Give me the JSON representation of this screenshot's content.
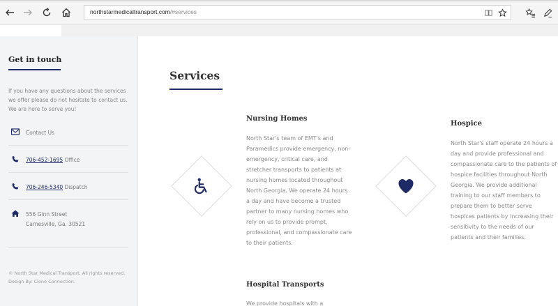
{
  "browser": {
    "url_host": "northstarmedicaltransport.com",
    "url_path": "/#services"
  },
  "sidebar": {
    "title": "Get in touch",
    "intro": "If you have any questions about the services we offer please do not hesitate to contact us. We are here to serve you!",
    "contact_label": "Contact Us",
    "phone_office_number": "706-452-1695",
    "phone_office_suffix": " Office",
    "phone_dispatch_number": "706-246-5340",
    "phone_dispatch_suffix": " Dispatch",
    "address_line1": "556 Ginn Street",
    "address_line2": "Carnesville, Ga. 30521",
    "footer": "© North Star Medical Transport. All rights reserved. Design By: Clone Connection."
  },
  "main": {
    "section_title": "Services",
    "services": [
      {
        "title": "Nursing Homes",
        "text": "North Star's team of EMT's and Paramedics provide emergency, non-emergency, critical care, and stretcher transports to patients at nursing homes located throughout North Georgia. We operate 24 hours a day and have become a trusted partner to many nursing homes who rely on us to provide prompt, professional, and compassionate care to their patients.",
        "icon": "wheelchair-icon"
      },
      {
        "title": "Hospice",
        "text": "North Star's staff operate 24 hours a day and provide professional and compassionate care to the patients of hospice facilities throughout North Georgia. We provide additional training to our staff members to prepare them to better serve hospices patients by increasing their sensitivity to the needs of our patients and their families.",
        "icon": "heart-icon"
      },
      {
        "title": "Hospital Transports",
        "text": "We provide hospitals with a"
      }
    ]
  },
  "colors": {
    "accent": "#1e2a66",
    "muted_text": "#888888"
  }
}
